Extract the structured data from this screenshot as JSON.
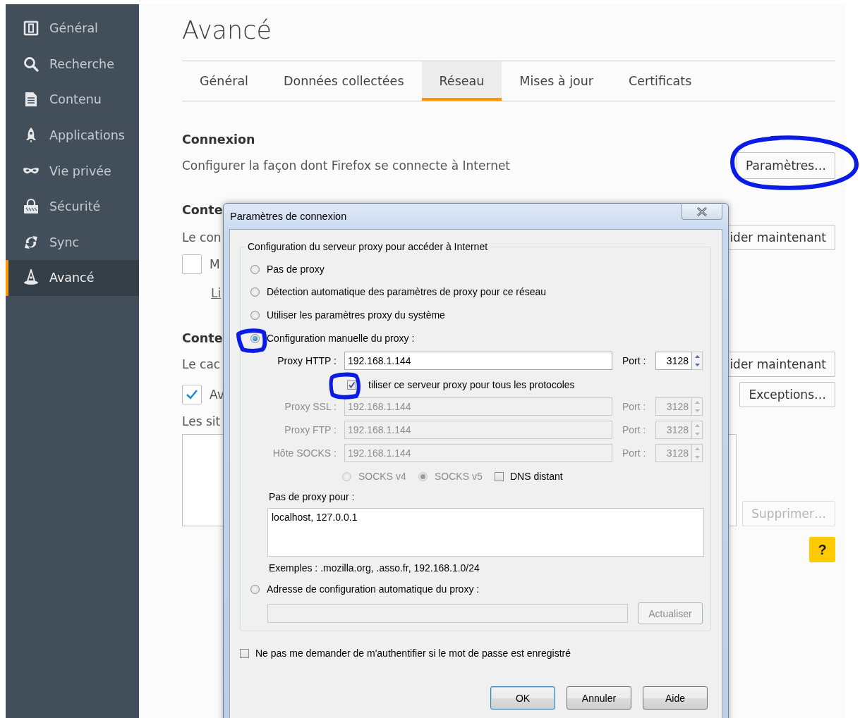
{
  "sidebar": {
    "items": [
      {
        "label": "Général",
        "selected": false
      },
      {
        "label": "Recherche",
        "selected": false
      },
      {
        "label": "Contenu",
        "selected": false
      },
      {
        "label": "Applications",
        "selected": false
      },
      {
        "label": "Vie privée",
        "selected": false
      },
      {
        "label": "Sécurité",
        "selected": false
      },
      {
        "label": "Sync",
        "selected": false
      },
      {
        "label": "Avancé",
        "selected": true
      }
    ]
  },
  "page": {
    "title": "Avancé",
    "tabs": [
      {
        "label": "Général",
        "selected": false
      },
      {
        "label": "Données collectées",
        "selected": false
      },
      {
        "label": "Réseau",
        "selected": true
      },
      {
        "label": "Mises à jour",
        "selected": false
      },
      {
        "label": "Certificats",
        "selected": false
      }
    ],
    "connexion": {
      "heading": "Connexion",
      "description": "Configurer la façon dont Firefox se connecte à Internet",
      "button": "Paramètres…"
    },
    "section_2": {
      "heading": "Conte",
      "text": "Le con",
      "button": "ider maintenant",
      "checkbox": {
        "label": "M",
        "checked": false
      },
      "link": "Li"
    },
    "section_3": {
      "heading": "Conte",
      "text": "Le cac",
      "button": "ider maintenant",
      "checkbox": {
        "label": "Av",
        "checked": true
      },
      "exceptions_button": "Exceptions…",
      "list_label": "Les sit",
      "remove_button": {
        "label": "Supprimer…",
        "disabled": true
      },
      "help_button": "?"
    }
  },
  "dialog": {
    "title": "Paramètres de connexion",
    "group_title": "Configuration du serveur proxy pour accéder à Internet",
    "modes": [
      {
        "label": "Pas de proxy",
        "selected": false
      },
      {
        "label": "Détection automatique des paramètres de proxy pour ce réseau",
        "selected": false
      },
      {
        "label": "Utiliser les paramètres proxy du système",
        "selected": false
      },
      {
        "label": "Configuration manuelle du proxy :",
        "selected": true
      }
    ],
    "proxies": [
      {
        "label": "Proxy HTTP :",
        "value": "192.168.1.144",
        "port_label": "Port :",
        "port": "3128",
        "disabled": false
      },
      {
        "label": "Proxy SSL :",
        "value": "192.168.1.144",
        "port_label": "Port :",
        "port": "3128",
        "disabled": true
      },
      {
        "label": "Proxy FTP :",
        "value": "192.168.1.144",
        "port_label": "Port :",
        "port": "3128",
        "disabled": true
      },
      {
        "label": "Hôte SOCKS :",
        "value": "192.168.1.144",
        "port_label": "Port :",
        "port": "3128",
        "disabled": true
      }
    ],
    "share_all": {
      "label": "tiliser ce serveur proxy pour tous les protocoles",
      "checked": true
    },
    "socks_versions": [
      {
        "label": "SOCKS v4",
        "selected": false,
        "disabled": true
      },
      {
        "label": "SOCKS v5",
        "selected": true,
        "disabled": true
      }
    ],
    "remote_dns": {
      "label": "DNS distant",
      "checked": false
    },
    "no_proxy_label": "Pas de proxy pour :",
    "no_proxy_value": "localhost, 127.0.0.1",
    "examples": "Exemples : .mozilla.org, .asso.fr, 192.168.1.0/24",
    "auto_config": {
      "label": "Adresse de configuration automatique du proxy :",
      "selected": false
    },
    "reload_button": {
      "label": "Actualiser",
      "disabled": true
    },
    "no_auth": {
      "label": "Ne pas me demander de m'authentifier si le mot de passe est enregistré",
      "checked": false
    },
    "buttons": [
      {
        "label": "OK",
        "default": true
      },
      {
        "label": "Annuler",
        "default": false
      },
      {
        "label": "Aide",
        "default": false
      }
    ]
  }
}
